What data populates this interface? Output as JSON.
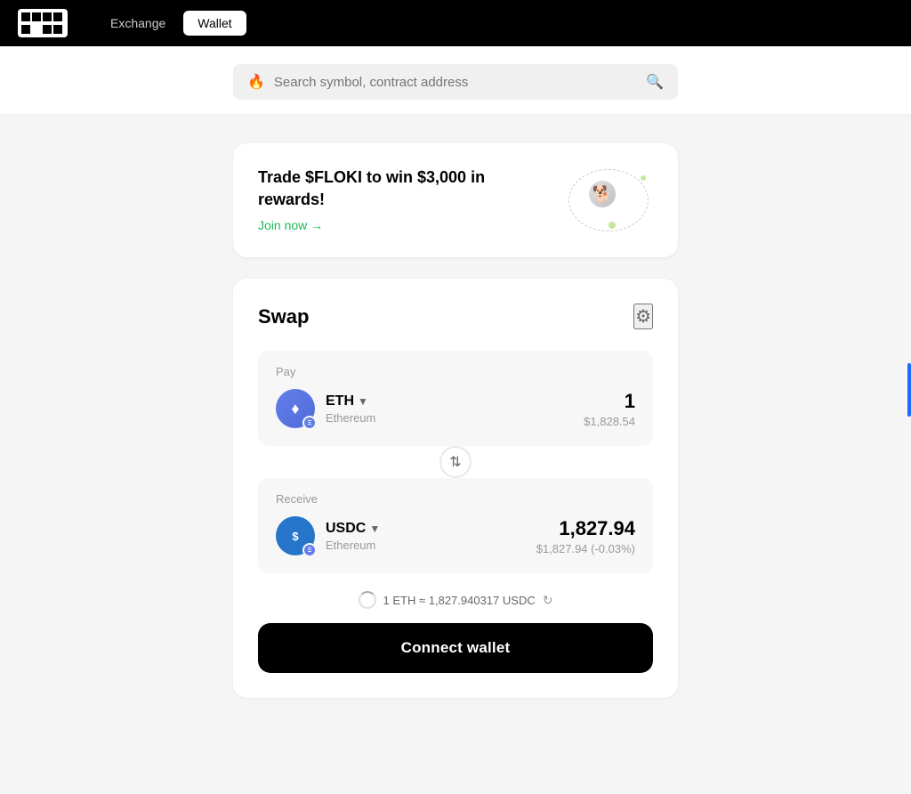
{
  "header": {
    "logo_alt": "OKX Logo",
    "nav": {
      "exchange_label": "Exchange",
      "wallet_label": "Wallet"
    }
  },
  "search": {
    "placeholder": "Search symbol, contract address",
    "fire_emoji": "🔥"
  },
  "promo": {
    "headline": "Trade $FLOKI to win $3,000 in rewards!",
    "cta_label": "Join now →",
    "carousel_dots": [
      false,
      true,
      false,
      false
    ]
  },
  "swap": {
    "title": "Swap",
    "settings_label": "⚙",
    "pay_label": "Pay",
    "receive_label": "Receive",
    "pay_token": {
      "name": "ETH",
      "full_name": "Ethereum",
      "amount": "1",
      "usd_value": "$1,828.54"
    },
    "receive_token": {
      "name": "USDC",
      "full_name": "Ethereum",
      "amount": "1,827.94",
      "usd_value": "$1,827.94 (-0.03%)"
    },
    "rate": "1 ETH ≈ 1,827.940317 USDC",
    "connect_wallet_label": "Connect wallet"
  },
  "scroll_indicator": true
}
